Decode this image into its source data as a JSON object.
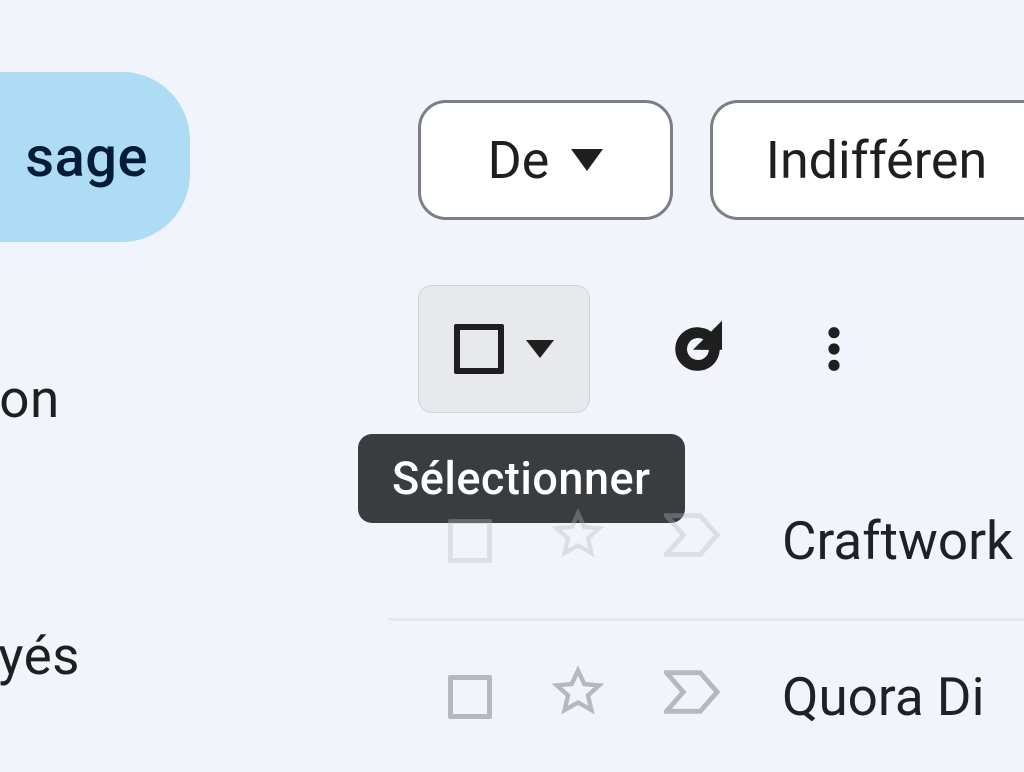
{
  "sidebar": {
    "compose_label": "sage",
    "items": [
      "tion",
      "oyés"
    ]
  },
  "filters": {
    "from_label": "De",
    "any_label": "Indifféren"
  },
  "toolbar": {
    "tooltip_select": "Sélectionner"
  },
  "mail": {
    "rows": [
      {
        "sender": "Craftwork"
      },
      {
        "sender": "Quora Di"
      }
    ]
  }
}
